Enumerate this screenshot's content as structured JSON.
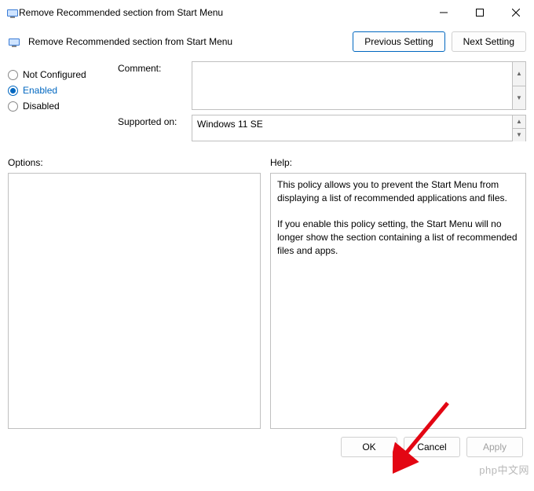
{
  "window": {
    "title": "Remove Recommended section from Start Menu"
  },
  "header": {
    "policy_name": "Remove Recommended section from Start Menu",
    "prev_label": "Previous Setting",
    "next_label": "Next Setting"
  },
  "state": {
    "options": [
      {
        "label": "Not Configured",
        "checked": false
      },
      {
        "label": "Enabled",
        "checked": true
      },
      {
        "label": "Disabled",
        "checked": false
      }
    ]
  },
  "fields": {
    "comment_label": "Comment:",
    "comment_value": "",
    "supported_label": "Supported on:",
    "supported_value": "Windows 11 SE"
  },
  "panels": {
    "options_label": "Options:",
    "help_label": "Help:",
    "help_text_p1": "This policy allows you to prevent the Start Menu from displaying a list of recommended applications and files.",
    "help_text_p2": "If you enable this policy setting, the Start Menu will no longer show the section containing a list of recommended files and apps."
  },
  "footer": {
    "ok": "OK",
    "cancel": "Cancel",
    "apply": "Apply"
  },
  "watermark": "php中文网"
}
